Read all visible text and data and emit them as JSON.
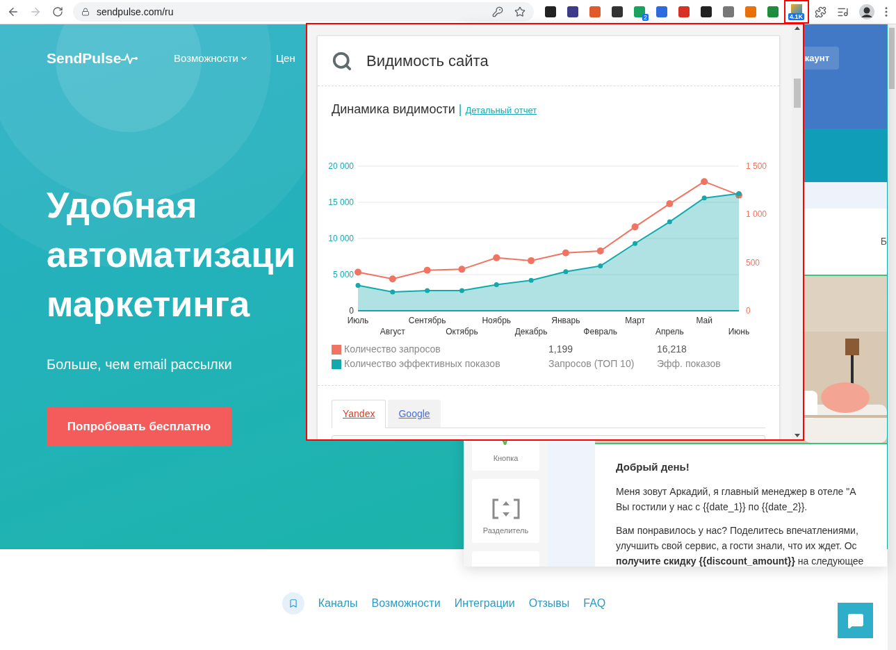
{
  "browser": {
    "url": "sendpulse.com/ru",
    "extensions": [
      {
        "kind": "plain"
      },
      {
        "kind": "plain"
      },
      {
        "kind": "plain"
      },
      {
        "kind": "plain"
      },
      {
        "kind": "badged",
        "badge": "2"
      },
      {
        "kind": "plain"
      },
      {
        "kind": "plain"
      },
      {
        "kind": "plain"
      },
      {
        "kind": "plain"
      },
      {
        "kind": "plain"
      },
      {
        "kind": "plain"
      },
      {
        "kind": "highlighted",
        "badge": "4.1K"
      }
    ]
  },
  "site": {
    "logo": "SendPulse",
    "nav": [
      {
        "label": "Возможности",
        "dropdown": true
      },
      {
        "label": "Цен",
        "dropdown": false
      }
    ],
    "headline": [
      "Удобная",
      "автоматизаци",
      "маркетинга"
    ],
    "subtitle": "Больше, чем email рассылки",
    "cta": "Попробовать бесплатно",
    "footer_nav": [
      "Каналы",
      "Возможности",
      "Интеграции",
      "Отзывы",
      "FAQ"
    ]
  },
  "mockup": {
    "account_button": "каунт",
    "cut_letter": "Б",
    "tools": [
      {
        "kind": "button",
        "label": "Кнопка"
      },
      {
        "kind": "divider",
        "label": "Разделитель"
      },
      {
        "kind": "blank"
      }
    ],
    "email": {
      "greeting": "Добрый день!",
      "paragraphs": [
        [
          "Меня зовут Аркадий, я главный менеджер в отеле \"А",
          "Вы гостили у нас с {{date_1}} по {{date_2}}."
        ],
        [
          "Вам понравилось у нас? Поделитесь впечатлениями,",
          "улучшить свой сервис, а гости знали, что их ждет. Ос",
          "**получите скидку {{discount_amount}}** на следующее"
        ]
      ]
    }
  },
  "popup": {
    "title": "Видимость сайта",
    "section_title": "Динамика видимости",
    "separator": "|",
    "report_link": "Детальный отчет",
    "chart_data": {
      "type": "line",
      "grid": true,
      "categories": [
        "Июль",
        "Август",
        "Сентябрь",
        "Октябрь",
        "Ноябрь",
        "Декабрь",
        "Январь",
        "Февраль",
        "Март",
        "Апрель",
        "Май",
        "Июнь"
      ],
      "ylim": [
        0,
        20000
      ],
      "yticks": [
        {
          "value": 0,
          "label": "0"
        },
        {
          "value": 5000,
          "label": "5 000"
        },
        {
          "value": 10000,
          "label": "10 000"
        },
        {
          "value": 15000,
          "label": "15 000"
        },
        {
          "value": 20000,
          "label": "20 000"
        }
      ],
      "y2lim": [
        0,
        1500
      ],
      "y2ticks": [
        {
          "value": 0,
          "label": "0"
        },
        {
          "value": 500,
          "label": "500"
        },
        {
          "value": 1000,
          "label": "1 000"
        },
        {
          "value": 1500,
          "label": "1 500"
        }
      ],
      "series": [
        {
          "name": "Количество запросов",
          "color": "#f07462",
          "axis": "y2",
          "type": "line",
          "marker": true,
          "values": [
            400,
            330,
            420,
            430,
            550,
            520,
            600,
            620,
            870,
            1110,
            1340,
            1200
          ]
        },
        {
          "name": "Количество эффективных показов",
          "color": "#13a8ab",
          "type": "area",
          "marker": true,
          "values": [
            3500,
            2600,
            2800,
            2800,
            3600,
            4200,
            5400,
            6200,
            9300,
            12300,
            15600,
            16200
          ]
        }
      ]
    },
    "stats": [
      {
        "value": "1,199",
        "label": "Запросов (ТОП 10)"
      },
      {
        "value": "16,218",
        "label": "Эфф. показов"
      }
    ],
    "tabs": [
      {
        "label": "Yandex",
        "selected": true
      },
      {
        "label": "Google",
        "selected": false
      }
    ]
  }
}
